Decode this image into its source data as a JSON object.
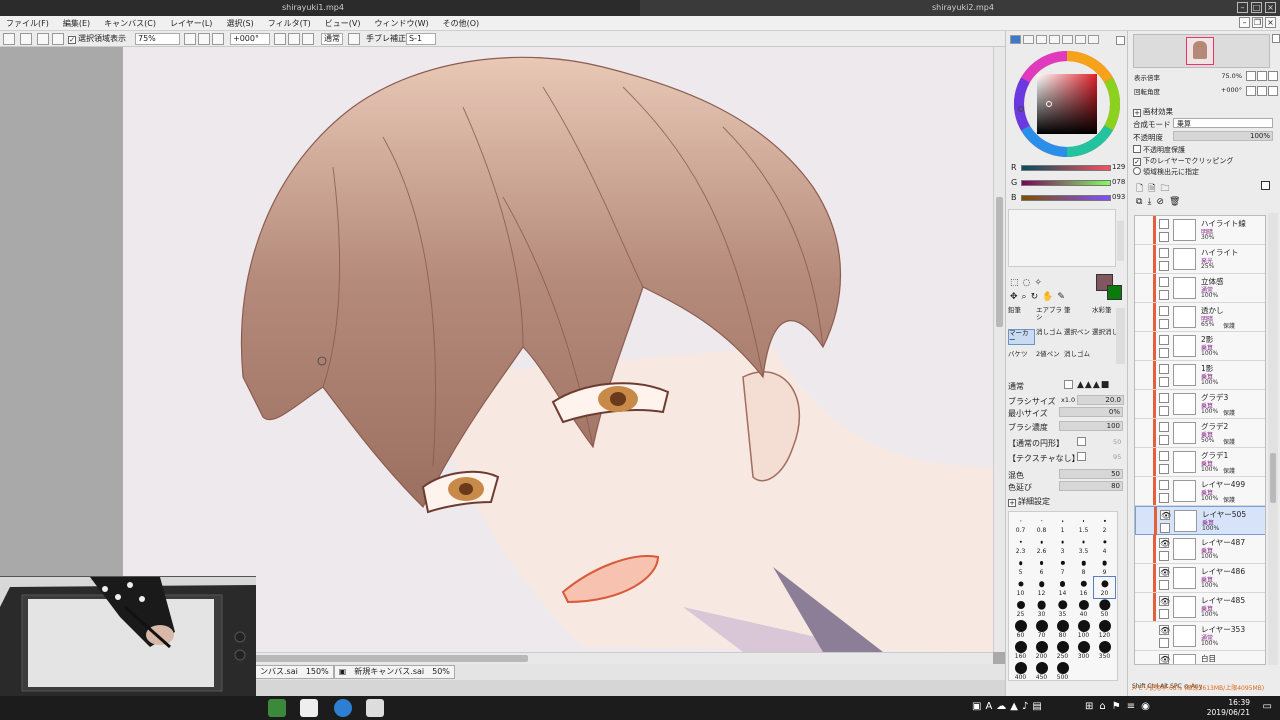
{
  "window": {
    "title_left": "shirayuki1.mp4",
    "title_right": "shirayuki2.mp4"
  },
  "menu": [
    "ファイル(F)",
    "編集(E)",
    "キャンバス(C)",
    "レイヤー(L)",
    "選択(S)",
    "フィルタ(T)",
    "ビュー(V)",
    "ウィンドウ(W)",
    "その他(O)"
  ],
  "toolbar": {
    "selection_display_label": "選択領域表示",
    "zoom": "75%",
    "rotation": "+000°",
    "blend": "通常",
    "stabilizer_label": "手ブレ補正",
    "stabilizer_value": "S-1"
  },
  "doc_tabs": [
    {
      "name": "ンバス.sai",
      "zoom": "150%"
    },
    {
      "name": "新規キャンバス.sai",
      "zoom": "50%"
    }
  ],
  "color": {
    "r": "129",
    "g": "078",
    "b": "093",
    "fg_color": "#81565f",
    "bg_color": "#0d7a10"
  },
  "tools": [
    {
      "label": "鉛筆"
    },
    {
      "label": "エアブラシ"
    },
    {
      "label": "筆"
    },
    {
      "label": "水彩筆"
    },
    {
      "label": "マーカー",
      "active": true
    },
    {
      "label": "消しゴム"
    },
    {
      "label": "選択ペン"
    },
    {
      "label": "選択消し"
    },
    {
      "label": "バケツ"
    },
    {
      "label": "2値ペン"
    },
    {
      "label": "消しゴム"
    },
    {
      "label": ""
    }
  ],
  "brush": {
    "mode": "通常",
    "size_label": "ブラシサイズ",
    "size_mult": "x1.0",
    "size_value": "20.0",
    "min_size_label": "最小サイズ",
    "min_size_value": "0%",
    "density_label": "ブラシ濃度",
    "density_value": "100",
    "shape": "【通常の円形】",
    "shape_value": "50",
    "texture": "【テクスチャなし】",
    "texture_value": "95",
    "blend_label": "混色",
    "blend_value": "50",
    "extend_label": "色延び",
    "extend_value": "80",
    "detail_label": "詳細設定"
  },
  "brush_sizes": [
    "0.7",
    "0.8",
    "1",
    "1.5",
    "2",
    "2.3",
    "2.6",
    "3",
    "3.5",
    "4",
    "5",
    "6",
    "7",
    "8",
    "9",
    "10",
    "12",
    "14",
    "16",
    "20",
    "25",
    "30",
    "35",
    "40",
    "50",
    "60",
    "70",
    "80",
    "100",
    "120",
    "160",
    "200",
    "250",
    "300",
    "350",
    "400",
    "450",
    "500"
  ],
  "navigator": {
    "zoom_label": "表示倍率",
    "zoom_value": "75.0%",
    "angle_label": "回転角度",
    "angle_value": "+000°"
  },
  "layer_props": {
    "effect_label": "画材効果",
    "blend_mode_label": "合成モード",
    "blend_mode_value": "乗算",
    "opacity_label": "不透明度",
    "opacity_value": "100%",
    "opt1": "不透明度保護",
    "opt2": "下のレイヤーでクリッピング",
    "opt3": "領域検出元に指定"
  },
  "layers": [
    {
      "name": "ハイライト線",
      "mode": "明暗",
      "opacity": "30%",
      "protect": "",
      "clip": true,
      "visible": false
    },
    {
      "name": "ハイライト",
      "mode": "発光",
      "opacity": "25%",
      "protect": "",
      "clip": true,
      "visible": false
    },
    {
      "name": "立体感",
      "mode": "通常",
      "opacity": "100%",
      "protect": "",
      "clip": true,
      "visible": false
    },
    {
      "name": "透かし",
      "mode": "明暗",
      "opacity": "65%",
      "protect": "保護",
      "clip": true,
      "visible": false
    },
    {
      "name": "2影",
      "mode": "乗算",
      "opacity": "100%",
      "protect": "",
      "clip": true,
      "visible": false
    },
    {
      "name": "1影",
      "mode": "乗算",
      "opacity": "100%",
      "protect": "",
      "clip": true,
      "visible": false
    },
    {
      "name": "グラデ3",
      "mode": "乗算",
      "opacity": "100%",
      "protect": "保護",
      "clip": true,
      "visible": false
    },
    {
      "name": "グラデ2",
      "mode": "乗算",
      "opacity": "50%",
      "protect": "保護",
      "clip": true,
      "visible": false
    },
    {
      "name": "グラデ1",
      "mode": "乗算",
      "opacity": "100%",
      "protect": "保護",
      "clip": true,
      "visible": false
    },
    {
      "name": "レイヤー499",
      "mode": "乗算",
      "opacity": "100%",
      "protect": "保護",
      "clip": true,
      "visible": false
    },
    {
      "name": "レイヤー505",
      "mode": "乗算",
      "opacity": "100%",
      "protect": "",
      "clip": true,
      "visible": true,
      "selected": true
    },
    {
      "name": "レイヤー487",
      "mode": "乗算",
      "opacity": "100%",
      "protect": "",
      "clip": true,
      "visible": true
    },
    {
      "name": "レイヤー486",
      "mode": "乗算",
      "opacity": "100%",
      "protect": "",
      "clip": true,
      "visible": true
    },
    {
      "name": "レイヤー485",
      "mode": "乗算",
      "opacity": "100%",
      "protect": "",
      "clip": true,
      "visible": true
    },
    {
      "name": "レイヤー353",
      "mode": "通常",
      "opacity": "100%",
      "protect": "",
      "clip": false,
      "visible": true
    },
    {
      "name": "白目",
      "mode": "",
      "opacity": "",
      "protect": "",
      "clip": false,
      "visible": true
    }
  ],
  "status": {
    "memory": "メモリ使用率:68% (確保3613MB/上限4095MB)",
    "keys": "Shift Ctrl Alt SPC ◎ Any"
  },
  "clock": {
    "time": "16:39",
    "date": "2019/06/21"
  }
}
